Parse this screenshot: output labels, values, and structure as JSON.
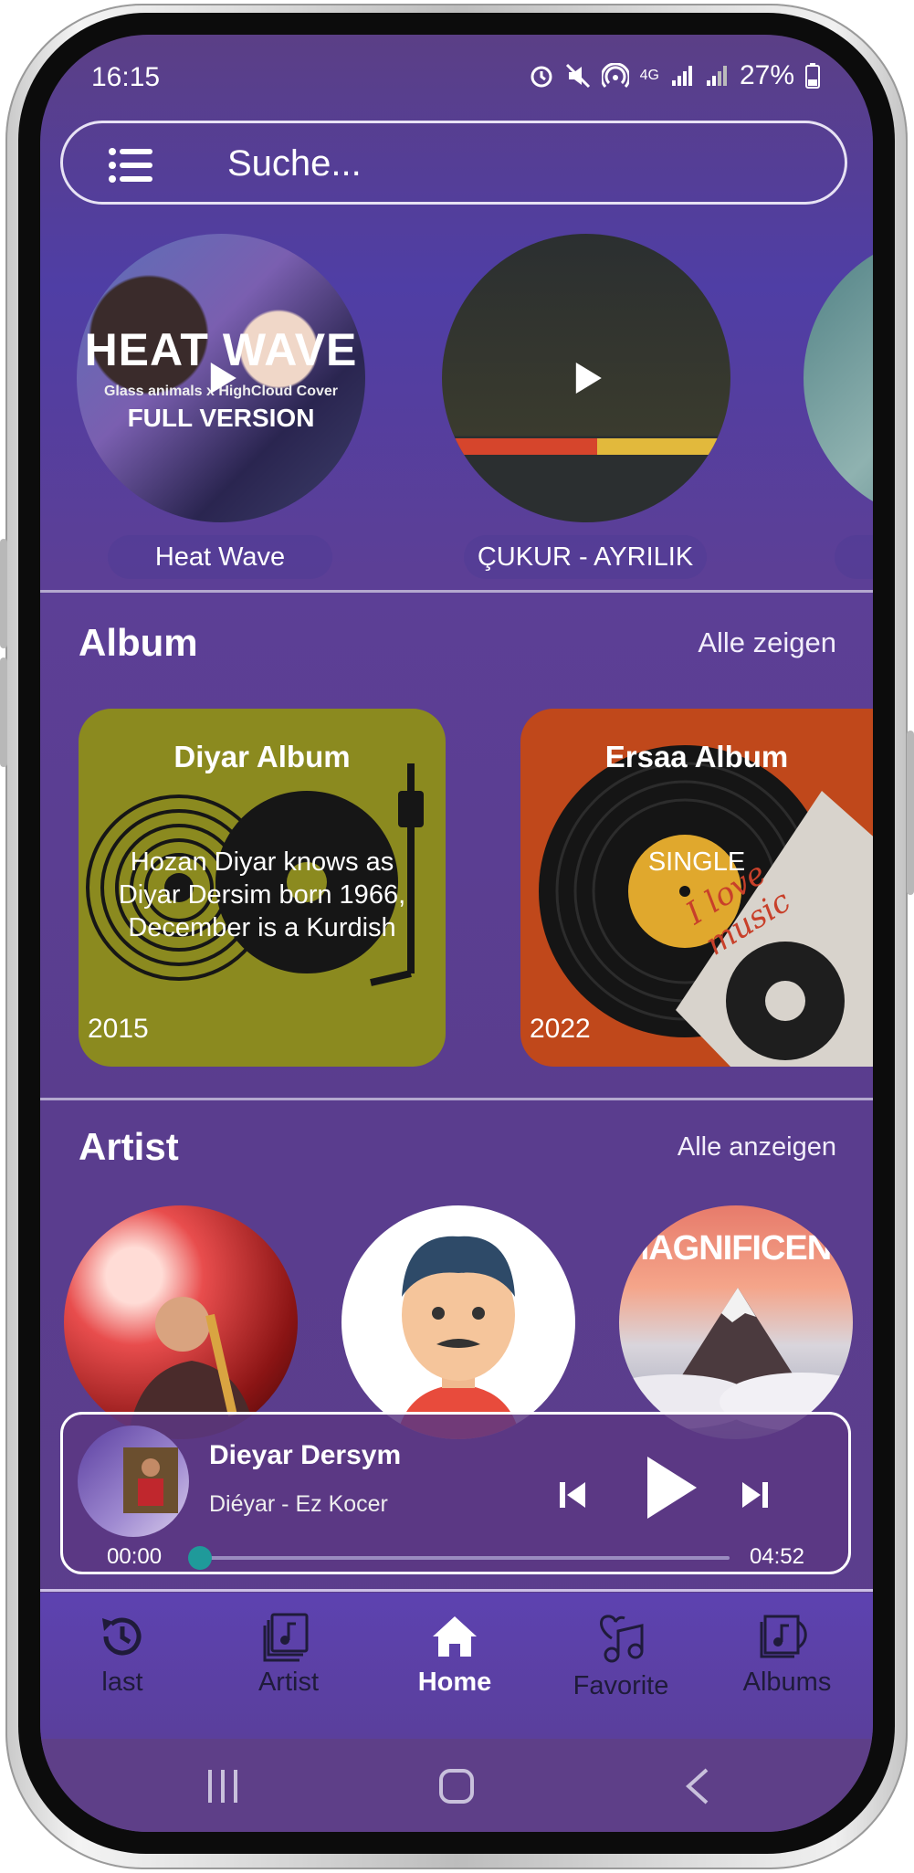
{
  "status_bar": {
    "time": "16:15",
    "battery": "27%",
    "network": "4G"
  },
  "search": {
    "placeholder": "Suche..."
  },
  "carousel": [
    {
      "caption": "Heat Wave",
      "cover_title": "HEAT WAVE",
      "cover_sub": "Glass animals x HighCloud Cover",
      "cover_sub2": "FULL VERSION"
    },
    {
      "caption": "ÇUKUR - AYRILIK"
    }
  ],
  "album_section": {
    "title": "Album",
    "link": "Alle zeigen",
    "items": [
      {
        "title": "Diyar Album",
        "desc": "Hozan Diyar knows as Diyar Dersim born 1966, December is a Kurdish",
        "year": "2015"
      },
      {
        "title": "Ersaa Album",
        "desc": "SINGLE",
        "year": "2022",
        "art_text": "I love music"
      }
    ]
  },
  "artist_section": {
    "title": "Artist",
    "link": "Alle anzeigen",
    "items": [
      {
        "name": "saxophone-player"
      },
      {
        "name": "cartoon-man"
      },
      {
        "name": "magnificent-mountain",
        "art_text": "MAGNIFICENT"
      }
    ]
  },
  "player": {
    "song": "Dieyar Dersym",
    "artist": "Diéyar - Ez Kocer",
    "elapsed": "00:00",
    "duration": "04:52",
    "progress": 0.0
  },
  "bottom_nav": [
    {
      "label": "last",
      "icon": "history-icon"
    },
    {
      "label": "Artist",
      "icon": "music-library-icon"
    },
    {
      "label": "Home",
      "icon": "home-icon",
      "active": true
    },
    {
      "label": "Favorite",
      "icon": "favorite-music-icon"
    },
    {
      "label": "Albums",
      "icon": "album-icon"
    }
  ],
  "colors": {
    "accent": "#1f9a9a",
    "background": "#5a3f96",
    "nav_inactive": "#1f1b3a"
  }
}
